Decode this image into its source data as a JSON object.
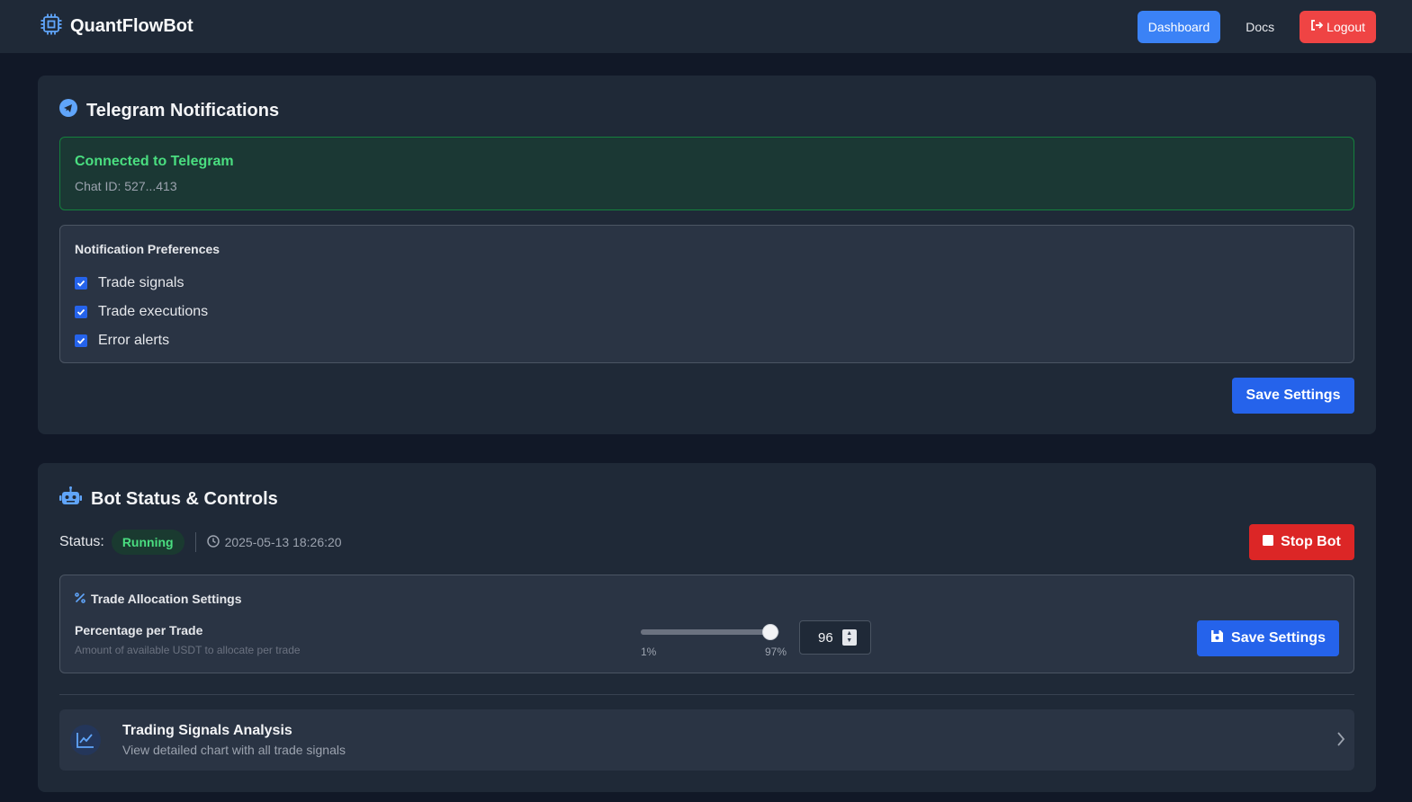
{
  "header": {
    "app_name": "QuantFlowBot",
    "nav": {
      "dashboard": "Dashboard",
      "docs": "Docs",
      "logout": "Logout"
    }
  },
  "telegram": {
    "title": "Telegram Notifications",
    "status": "Connected to Telegram",
    "chat_id": "Chat ID: 527...413",
    "prefs_title": "Notification Preferences",
    "preferences": [
      {
        "label": "Trade signals",
        "checked": true
      },
      {
        "label": "Trade executions",
        "checked": true
      },
      {
        "label": "Error alerts",
        "checked": true
      }
    ],
    "save_label": "Save Settings"
  },
  "bot": {
    "title": "Bot Status & Controls",
    "status_label": "Status:",
    "status_value": "Running",
    "timestamp": "2025-05-13 18:26:20",
    "stop_label": "Stop Bot",
    "allocation": {
      "title": "Trade Allocation Settings",
      "label": "Percentage per Trade",
      "description": "Amount of available USDT to allocate per trade",
      "slider_min": "1%",
      "slider_max": "97%",
      "slider_value": 96,
      "value": "96",
      "save_label": "Save Settings"
    },
    "signals": {
      "title": "Trading Signals Analysis",
      "subtitle": "View detailed chart with all trade signals"
    }
  },
  "colors": {
    "accent": "#2563eb",
    "success": "#4ade80",
    "danger": "#dc2626",
    "background": "#111827",
    "card": "#1f2937"
  }
}
